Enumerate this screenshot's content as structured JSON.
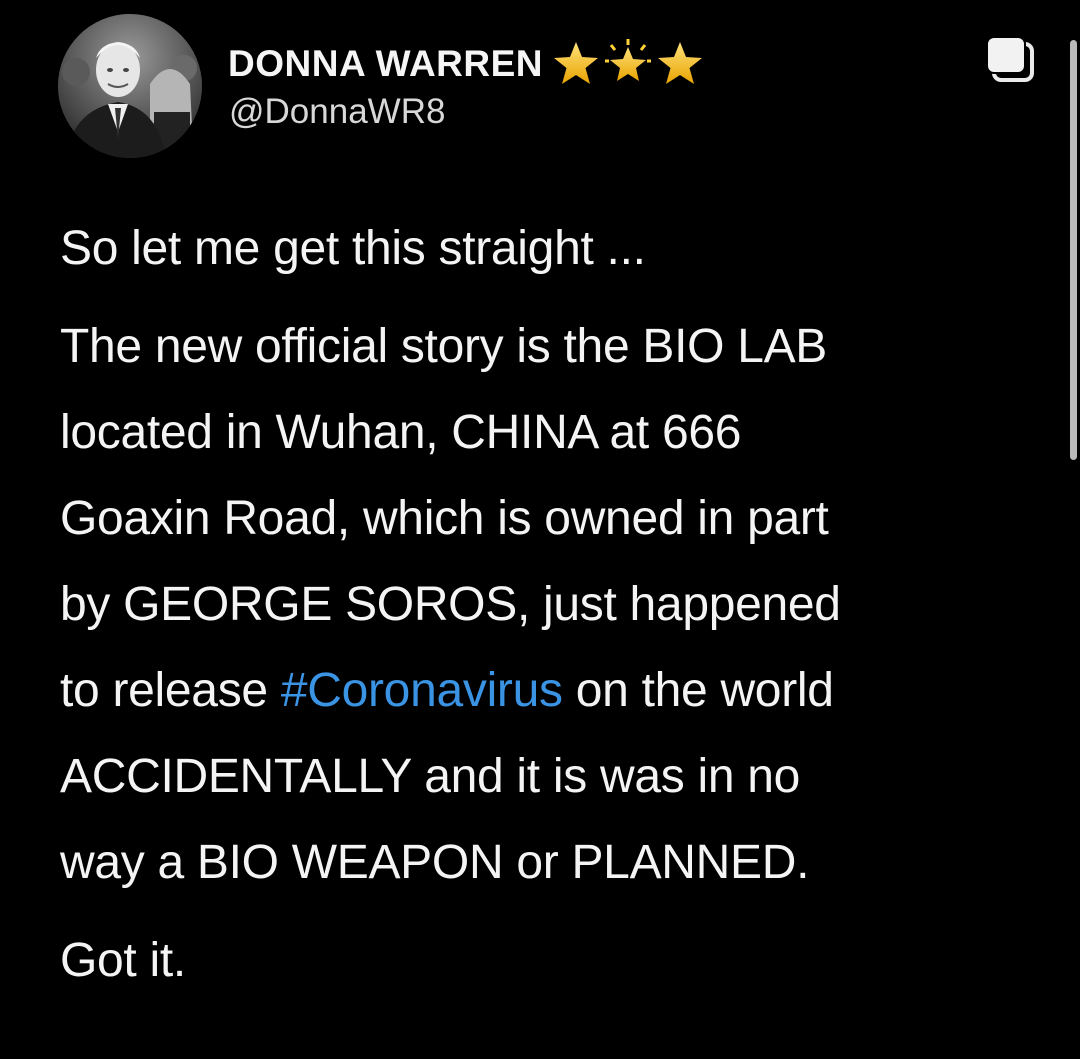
{
  "tweet": {
    "display_name": "DONNA WARREN",
    "handle": "@DonnaWR8",
    "badge_icons": [
      "star-icon",
      "sparkle-star-icon",
      "star-icon"
    ],
    "avatar_icon": "profile-photo",
    "intro": "So let me get this straight ...",
    "body_lines": {
      "l1": "The new official story is the BIO LAB",
      "l2": "located in Wuhan, CHINA at 666",
      "l3": "Goaxin Road, which is owned in part",
      "l4": "by GEORGE SOROS, just happened",
      "l5_before": "to release ",
      "l5_hashtag": "#Coronavirus",
      "l5_after": " on the world",
      "l6": "ACCIDENTALLY and it is was in no",
      "l7": "way a BIO WEAPON or PLANNED."
    },
    "closing": "Got it."
  },
  "colors": {
    "background": "#000000",
    "text": "#f4f4f4",
    "hashtag": "#3a93e3",
    "star": "#f5c518"
  }
}
